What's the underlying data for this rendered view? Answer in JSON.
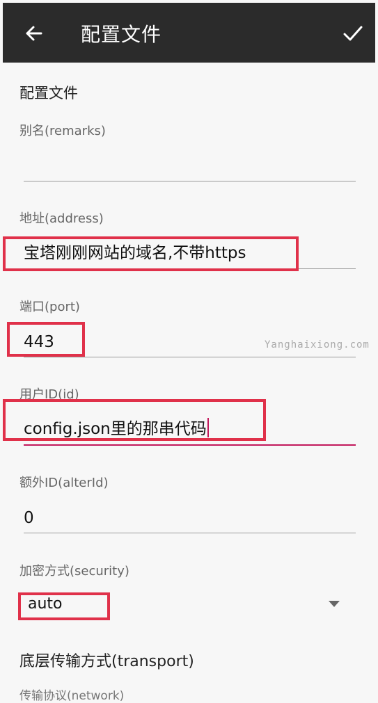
{
  "toolbar": {
    "title": "配置文件"
  },
  "section": {
    "title": "配置文件",
    "transport_title": "底层传输方式(transport)",
    "next_label_partial": "传输协议(network)"
  },
  "fields": {
    "remarks": {
      "label": "别名(remarks)",
      "value": ""
    },
    "address": {
      "label": "地址(address)",
      "value": "宝塔刚刚网站的域名,不带https"
    },
    "port": {
      "label": "端口(port)",
      "value": "443"
    },
    "id": {
      "label": "用户ID(id)",
      "value": "config.json里的那串代码"
    },
    "alterId": {
      "label": "额外ID(alterId)",
      "value": "0"
    },
    "security": {
      "label": "加密方式(security)",
      "value": "auto"
    }
  },
  "watermark": "Yanghaixiong.com",
  "colors": {
    "toolbar_bg": "#2b2b2b",
    "accent": "#c2185b",
    "highlight_box": "#e0314a"
  }
}
